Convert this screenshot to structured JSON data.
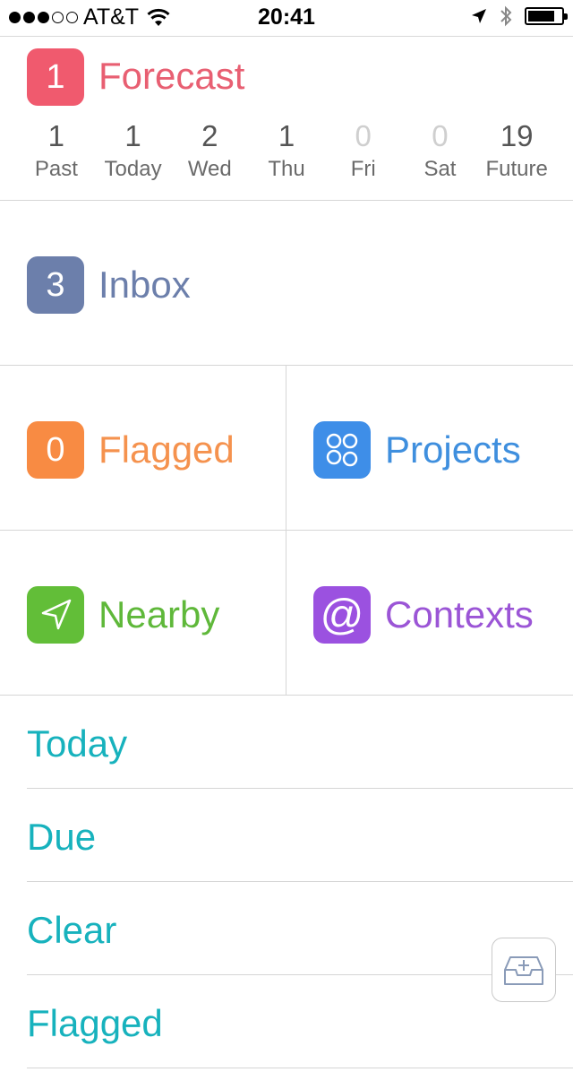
{
  "status_bar": {
    "carrier": "AT&T",
    "time": "20:41",
    "signal_bars_filled": 3,
    "signal_bars_total": 5,
    "battery_level": 0.8
  },
  "forecast": {
    "badge": "1",
    "title": "Forecast",
    "color": "#f05a6e",
    "days": [
      {
        "count": "1",
        "label": "Past"
      },
      {
        "count": "1",
        "label": "Today"
      },
      {
        "count": "2",
        "label": "Wed"
      },
      {
        "count": "1",
        "label": "Thu"
      },
      {
        "count": "0",
        "label": "Fri"
      },
      {
        "count": "0",
        "label": "Sat"
      },
      {
        "count": "19",
        "label": "Future"
      }
    ]
  },
  "inbox": {
    "badge": "3",
    "title": "Inbox",
    "color": "#6c7fab"
  },
  "flagged": {
    "badge": "0",
    "title": "Flagged",
    "color": "#f88b43"
  },
  "projects": {
    "title": "Projects",
    "icon": "projects-icon",
    "color": "#3e8ee8"
  },
  "nearby": {
    "title": "Nearby",
    "icon": "location-arrow-icon",
    "color": "#62be38"
  },
  "contexts": {
    "title": "Contexts",
    "icon": "at-sign-icon",
    "icon_glyph": "@",
    "color": "#9b51e0"
  },
  "perspectives": [
    "Today",
    "Due",
    "Clear",
    "Flagged"
  ],
  "quick_entry": {
    "icon": "inbox-add-icon"
  }
}
